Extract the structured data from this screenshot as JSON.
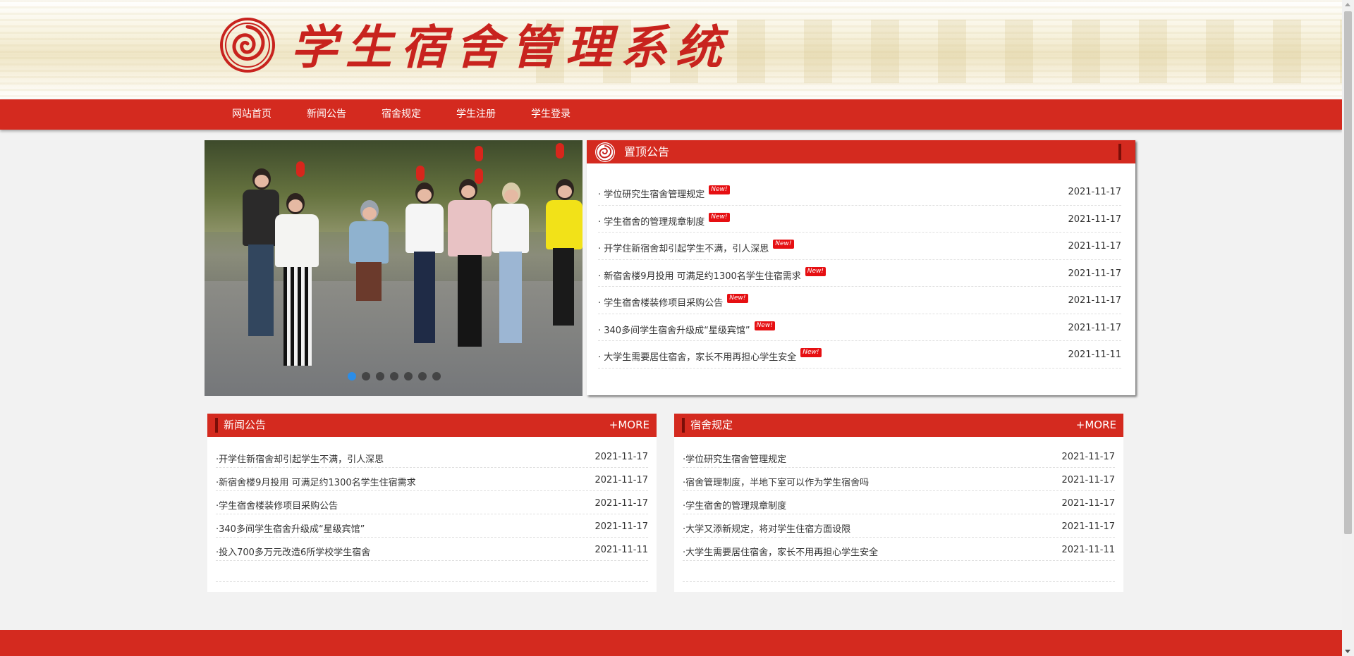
{
  "header": {
    "site_title": "学生宿舍管理系统",
    "logo_icon": "rose-emblem-icon",
    "accent_color": "#d42a1f"
  },
  "nav": {
    "items": [
      {
        "label": "网站首页"
      },
      {
        "label": "新闻公告"
      },
      {
        "label": "宿舍规定"
      },
      {
        "label": "学生注册"
      },
      {
        "label": "学生登录"
      }
    ]
  },
  "slider": {
    "slide_count": 7,
    "active_index": 0
  },
  "top_notice": {
    "title": "置顶公告",
    "badge_label": "New!",
    "items": [
      {
        "title": "· 学位研究生宿舍管理规定",
        "date": "2021-11-17"
      },
      {
        "title": "· 学生宿舍的管理规章制度",
        "date": "2021-11-17"
      },
      {
        "title": "· 开学住新宿舍却引起学生不满，引人深思",
        "date": "2021-11-17"
      },
      {
        "title": "· 新宿舍楼9月投用 可满足约1300名学生住宿需求",
        "date": "2021-11-17"
      },
      {
        "title": "· 学生宿舍楼装修项目采购公告",
        "date": "2021-11-17"
      },
      {
        "title": "· 340多间学生宿舍升级成“星级宾馆”",
        "date": "2021-11-17"
      },
      {
        "title": "· 大学生需要居住宿舍，家长不用再担心学生安全",
        "date": "2021-11-11"
      }
    ]
  },
  "news_panel": {
    "title": "新闻公告",
    "more_label": "+MORE",
    "items": [
      {
        "title": "·开学住新宿舍却引起学生不满，引人深思",
        "date": "2021-11-17"
      },
      {
        "title": "·新宿舍楼9月投用 可满足约1300名学生住宿需求",
        "date": "2021-11-17"
      },
      {
        "title": "·学生宿舍楼装修项目采购公告",
        "date": "2021-11-17"
      },
      {
        "title": "·340多间学生宿舍升级成“星级宾馆”",
        "date": "2021-11-17"
      },
      {
        "title": "·投入700多万元改造6所学校学生宿舍",
        "date": "2021-11-11"
      }
    ]
  },
  "rules_panel": {
    "title": "宿舍规定",
    "more_label": "+MORE",
    "items": [
      {
        "title": "·学位研究生宿舍管理规定",
        "date": "2021-11-17"
      },
      {
        "title": "·宿舍管理制度，半地下室可以作为学生宿舍吗",
        "date": "2021-11-17"
      },
      {
        "title": "·学生宿舍的管理规章制度",
        "date": "2021-11-17"
      },
      {
        "title": "·大学又添新规定，将对学生住宿方面设限",
        "date": "2021-11-17"
      },
      {
        "title": "·大学生需要居住宿舍，家长不用再担心学生安全",
        "date": "2021-11-11"
      }
    ]
  }
}
